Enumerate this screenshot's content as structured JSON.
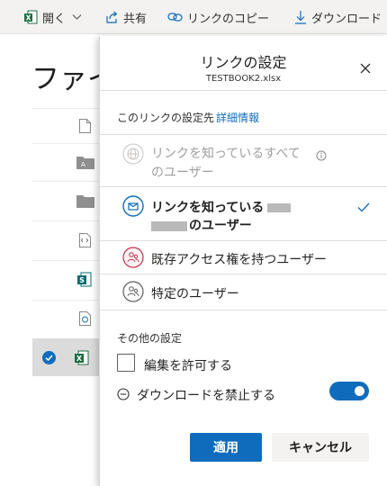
{
  "toolbar": {
    "open_label": "開く",
    "share_label": "共有",
    "copy_link_label": "リンクのコピー",
    "download_label": "ダウンロード"
  },
  "background": {
    "title": "ファイ"
  },
  "panel": {
    "title": "リンクの設定",
    "filename": "TESTBOOK2.xlsx",
    "scope_label": "このリンクの設定先",
    "details_link": "詳細情報",
    "options": [
      {
        "line1": "リンクを知っているすべて",
        "line2": "のユーザー",
        "state": "disabled"
      },
      {
        "line1": "リンクを知っている",
        "line2": "のユーザー",
        "state": "selected"
      },
      {
        "line1": "既存アクセス権を持つユーザー",
        "state": "normal"
      },
      {
        "line1": "特定のユーザー",
        "state": "normal"
      }
    ],
    "other_settings_label": "その他の設定",
    "allow_edit_label": "編集を許可する",
    "allow_edit_checked": false,
    "block_download_label": "ダウンロードを禁止する",
    "block_download_on": true,
    "apply_label": "適用",
    "cancel_label": "キャンセル"
  },
  "colors": {
    "accent": "#0f6cbd",
    "excel_green": "#1d6f42"
  }
}
